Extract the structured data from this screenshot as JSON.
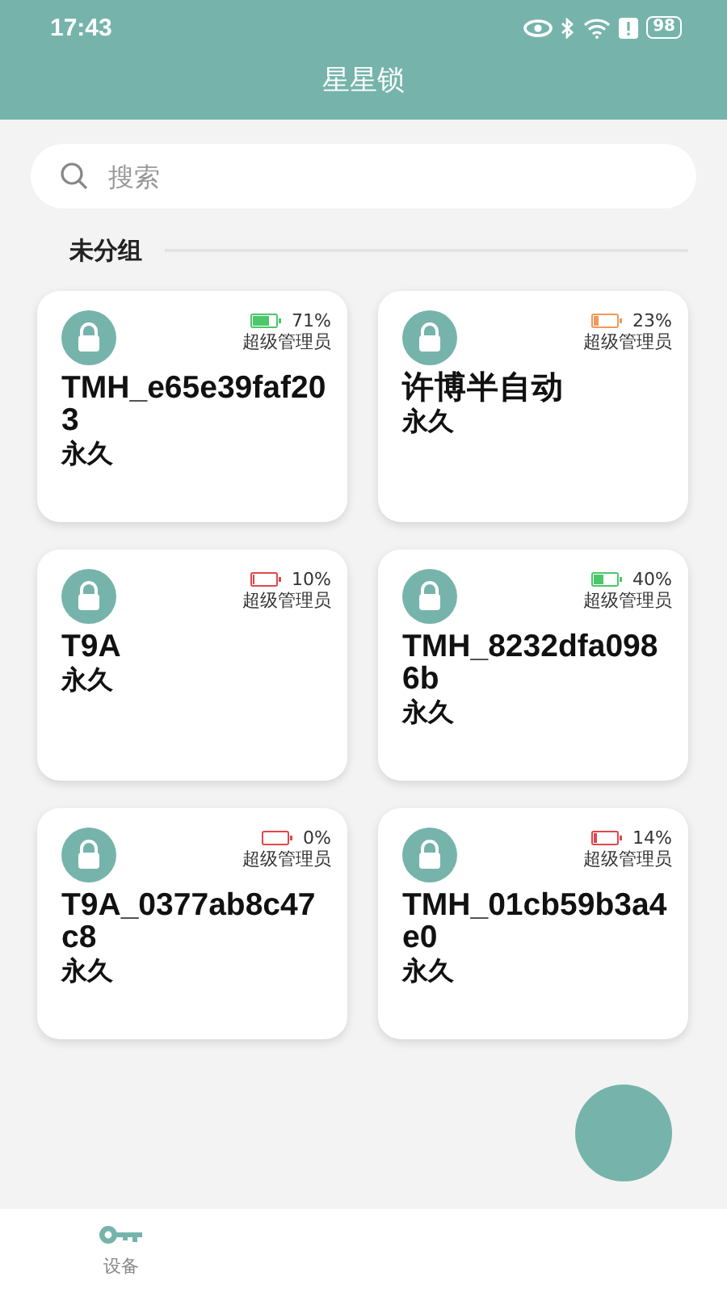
{
  "status_bar": {
    "time": "17:43",
    "battery": "98"
  },
  "header": {
    "title": "星星锁"
  },
  "search": {
    "placeholder": "搜索"
  },
  "group": {
    "title": "未分组"
  },
  "locks": [
    {
      "name": "TMH_e65e39faf203",
      "battery": "71%",
      "role": "超级管理员",
      "validity": "永久"
    },
    {
      "name": "许博半自动",
      "battery": "23%",
      "role": "超级管理员",
      "validity": "永久"
    },
    {
      "name": "T9A",
      "battery": "10%",
      "role": "超级管理员",
      "validity": "永久"
    },
    {
      "name": "TMH_8232dfa0986b",
      "battery": "40%",
      "role": "超级管理员",
      "validity": "永久"
    },
    {
      "name": "T9A_0377ab8c47c8",
      "battery": "0%",
      "role": "超级管理员",
      "validity": "永久"
    },
    {
      "name": "TMH_01cb59b3a4e0",
      "battery": "14%",
      "role": "超级管理员",
      "validity": "永久"
    }
  ],
  "nav": [
    {
      "label": "设备",
      "selected": true
    }
  ]
}
